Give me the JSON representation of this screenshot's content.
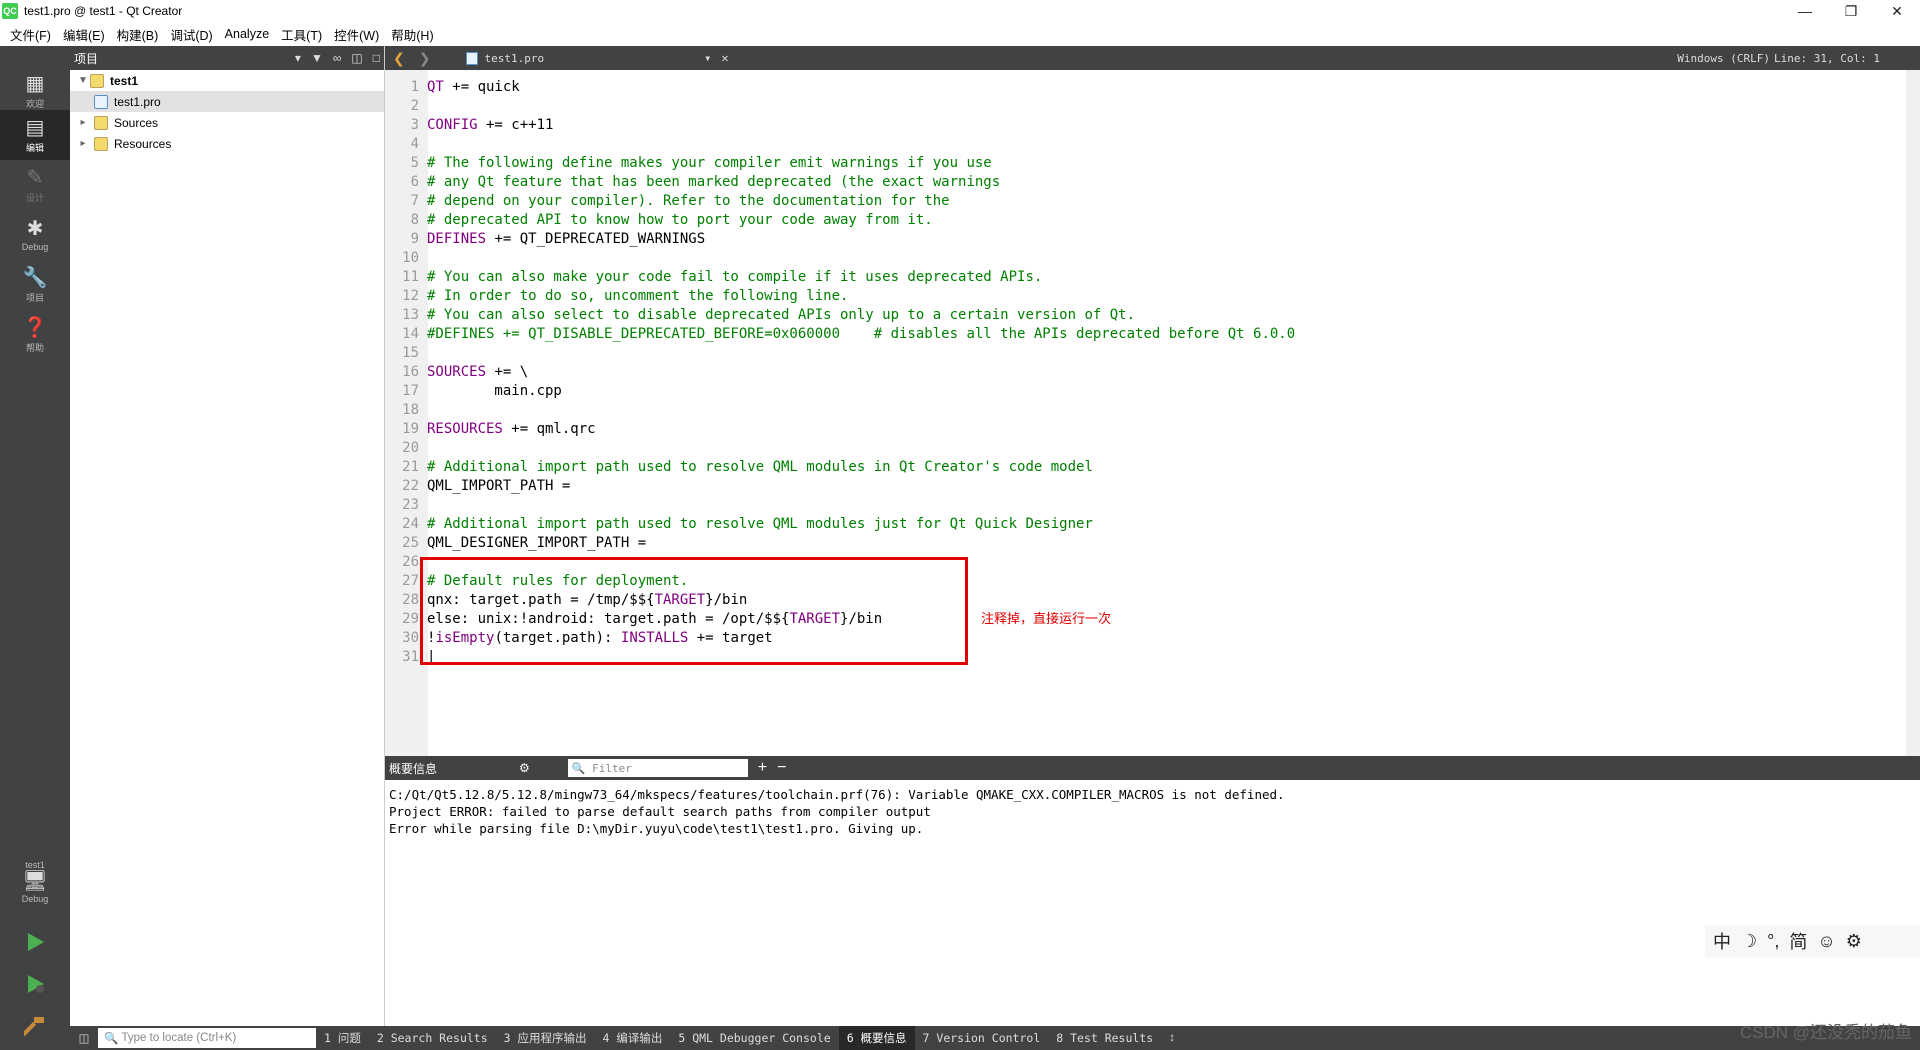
{
  "window": {
    "title": "test1.pro @ test1 - Qt Creator",
    "app_icon": "QC"
  },
  "menu": [
    "文件(F)",
    "编辑(E)",
    "构建(B)",
    "调试(D)",
    "Analyze",
    "工具(T)",
    "控件(W)",
    "帮助(H)"
  ],
  "modes": [
    {
      "label": "欢迎",
      "icon": "grid-icon"
    },
    {
      "label": "编辑",
      "icon": "edit-icon"
    },
    {
      "label": "设计",
      "icon": "pencil-icon"
    },
    {
      "label": "Debug",
      "icon": "bug-icon"
    },
    {
      "label": "项目",
      "icon": "wrench-icon"
    },
    {
      "label": "帮助",
      "icon": "help-icon"
    }
  ],
  "kit": {
    "project": "test1",
    "config": "Debug"
  },
  "project_pane": {
    "title": "项目",
    "tree": [
      {
        "label": "test1",
        "level": 0
      },
      {
        "label": "test1.pro",
        "level": 1,
        "selected": true
      },
      {
        "label": "Sources",
        "level": 1
      },
      {
        "label": "Resources",
        "level": 1
      }
    ]
  },
  "editor_toolbar": {
    "document": "test1.pro",
    "encoding": "Windows (CRLF)",
    "position": "Line: 31, Col: 1"
  },
  "code": [
    {
      "n": "1",
      "parts": [
        [
          "kw",
          "QT"
        ],
        [
          "pl",
          " += quick"
        ]
      ]
    },
    {
      "n": "2",
      "parts": []
    },
    {
      "n": "3",
      "parts": [
        [
          "kw",
          "CONFIG"
        ],
        [
          "pl",
          " += c++11"
        ]
      ]
    },
    {
      "n": "4",
      "parts": []
    },
    {
      "n": "5",
      "parts": [
        [
          "cm",
          "# The following define makes your compiler emit warnings if you use"
        ]
      ]
    },
    {
      "n": "6",
      "parts": [
        [
          "cm",
          "# any Qt feature that has been marked deprecated (the exact warnings"
        ]
      ]
    },
    {
      "n": "7",
      "parts": [
        [
          "cm",
          "# depend on your compiler). Refer to the documentation for the"
        ]
      ]
    },
    {
      "n": "8",
      "parts": [
        [
          "cm",
          "# deprecated API to know how to port your code away from it."
        ]
      ]
    },
    {
      "n": "9",
      "parts": [
        [
          "kw",
          "DEFINES"
        ],
        [
          "pl",
          " += QT_DEPRECATED_WARNINGS"
        ]
      ]
    },
    {
      "n": "10",
      "parts": []
    },
    {
      "n": "11",
      "parts": [
        [
          "cm",
          "# You can also make your code fail to compile if it uses deprecated APIs."
        ]
      ]
    },
    {
      "n": "12",
      "parts": [
        [
          "cm",
          "# In order to do so, uncomment the following line."
        ]
      ]
    },
    {
      "n": "13",
      "parts": [
        [
          "cm",
          "# You can also select to disable deprecated APIs only up to a certain version of Qt."
        ]
      ]
    },
    {
      "n": "14",
      "parts": [
        [
          "cm",
          "#DEFINES += QT_DISABLE_DEPRECATED_BEFORE=0x060000    # disables all the APIs deprecated before Qt 6.0.0"
        ]
      ]
    },
    {
      "n": "15",
      "parts": []
    },
    {
      "n": "16",
      "parts": [
        [
          "kw",
          "SOURCES"
        ],
        [
          "pl",
          " += \\"
        ]
      ]
    },
    {
      "n": "17",
      "parts": [
        [
          "pl",
          "        main.cpp"
        ]
      ]
    },
    {
      "n": "18",
      "parts": []
    },
    {
      "n": "19",
      "parts": [
        [
          "kw",
          "RESOURCES"
        ],
        [
          "pl",
          " += qml.qrc"
        ]
      ]
    },
    {
      "n": "20",
      "parts": []
    },
    {
      "n": "21",
      "parts": [
        [
          "cm",
          "# Additional import path used to resolve QML modules in Qt Creator's code model"
        ]
      ]
    },
    {
      "n": "22",
      "parts": [
        [
          "pl",
          "QML_IMPORT_PATH ="
        ]
      ]
    },
    {
      "n": "23",
      "parts": []
    },
    {
      "n": "24",
      "parts": [
        [
          "cm",
          "# Additional import path used to resolve QML modules just for Qt Quick Designer"
        ]
      ]
    },
    {
      "n": "25",
      "parts": [
        [
          "pl",
          "QML_DESIGNER_IMPORT_PATH ="
        ]
      ]
    },
    {
      "n": "26",
      "parts": []
    },
    {
      "n": "27",
      "parts": [
        [
          "cm",
          "# Default rules for deployment."
        ]
      ]
    },
    {
      "n": "28",
      "parts": [
        [
          "pl",
          "qnx: target.path = /tmp/$${"
        ],
        [
          "kw",
          "TARGET"
        ],
        [
          "pl",
          "}/bin"
        ]
      ]
    },
    {
      "n": "29",
      "parts": [
        [
          "pl",
          "else: unix:!android: target.path = /opt/$${"
        ],
        [
          "kw",
          "TARGET"
        ],
        [
          "pl",
          "}/bin"
        ]
      ]
    },
    {
      "n": "30",
      "parts": [
        [
          "pl",
          "!"
        ],
        [
          "kw",
          "isEmpty"
        ],
        [
          "pl",
          "(target.path): "
        ],
        [
          "kw",
          "INSTALLS"
        ],
        [
          "pl",
          " += target"
        ]
      ]
    },
    {
      "n": "31",
      "parts": [
        [
          "pl",
          "|"
        ]
      ]
    }
  ],
  "annotation": "注释掉，直接运行一次",
  "output_pane": {
    "title": "概要信息",
    "filter_placeholder": "Filter",
    "lines": [
      "C:/Qt/Qt5.12.8/5.12.8/mingw73_64/mkspecs/features/toolchain.prf(76): Variable QMAKE_CXX.COMPILER_MACROS is not defined.",
      "Project ERROR: failed to parse default search paths from compiler output",
      "Error while parsing file D:\\myDir.yuyu\\code\\test1\\test1.pro. Giving up."
    ]
  },
  "ime": [
    "中",
    "☽",
    "°,",
    "简",
    "☺",
    "⚙"
  ],
  "statusbar": {
    "locate_placeholder": "Type to locate (Ctrl+K)",
    "tabs": [
      "1 问题",
      "2 Search Results",
      "3 应用程序输出",
      "4 编译输出",
      "5 QML Debugger Console",
      "6 概要信息",
      "7 Version Control",
      "8 Test Results"
    ],
    "active_tab": 5
  },
  "watermark": "CSDN @还没秃的茄鱼",
  "colors": {
    "keyword": "#800080",
    "comment": "#008000",
    "highlight_box": "#e00000",
    "sidebar": "#404244"
  }
}
